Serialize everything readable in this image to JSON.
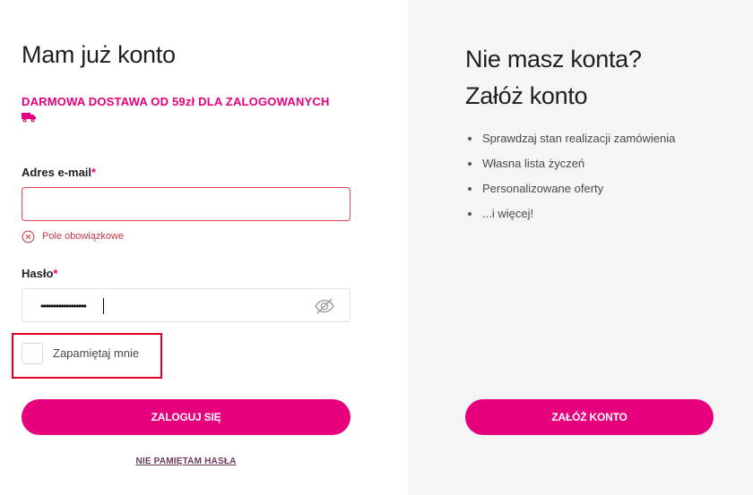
{
  "login": {
    "title": "Mam już konto",
    "promo": "DARMOWA DOSTAWA OD 59zł DLA ZALOGOWANYCH",
    "email_label": "Adres e-mail",
    "required_mark": "*",
    "email_value": "",
    "email_error": "Pole obowiązkowe",
    "password_label": "Hasło",
    "password_value": "••••••••••••••••••",
    "remember_label": "Zapamiętaj mnie",
    "remember_checked": false,
    "login_button": "ZALOGUJ SIĘ",
    "forgot_link": "NIE PAMIĘTAM HASŁA"
  },
  "register": {
    "title_line1": "Nie masz konta?",
    "title_line2": "Załóż konto",
    "benefits": [
      "Sprawdzaj stan realizacji zamówienia",
      "Własna lista życzeń",
      "Personalizowane oferty",
      "...i więcej!"
    ],
    "register_button": "ZAŁÓŻ KONTO"
  },
  "icons": {
    "truck": "truck-icon",
    "error": "error-circle-x-icon",
    "password_toggle": "eye-slash-icon"
  },
  "colors": {
    "brand": "#e6007e",
    "error": "#d0343f",
    "highlight": "#e4001c",
    "panel_bg": "#f5f5f5"
  }
}
